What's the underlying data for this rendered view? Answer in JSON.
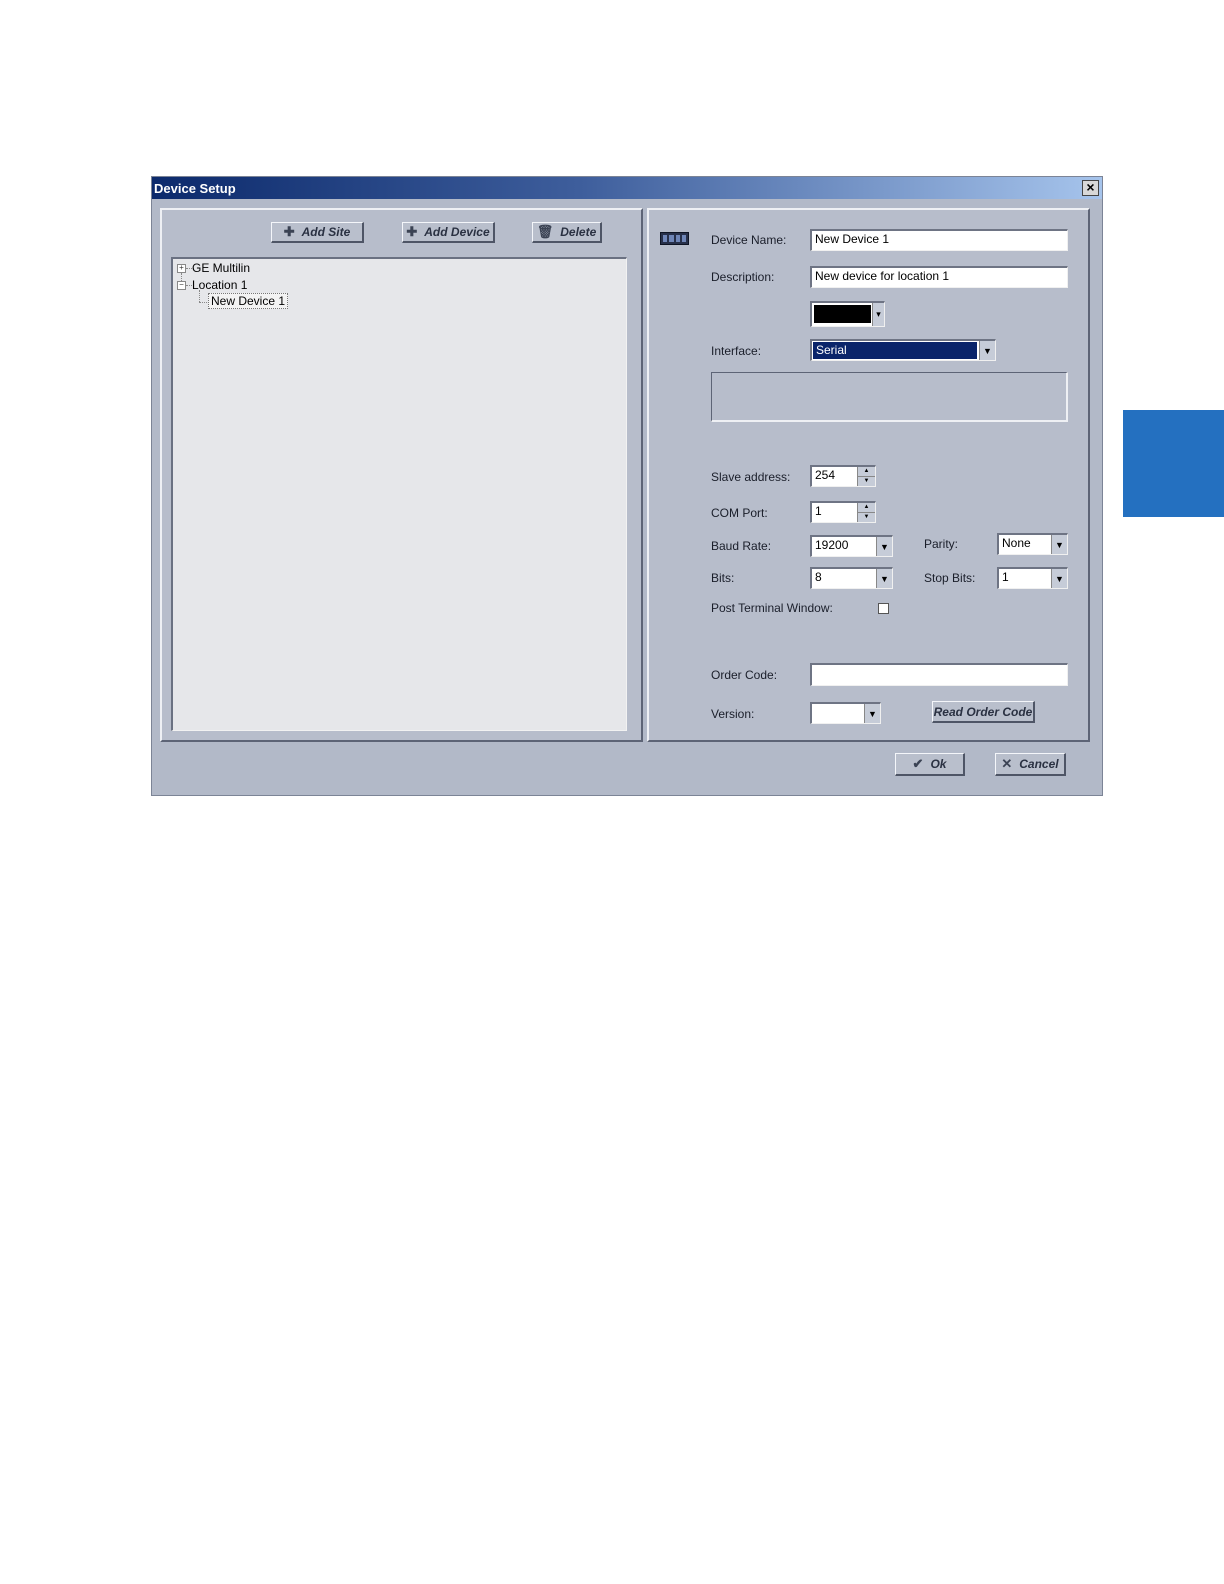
{
  "window": {
    "title": "Device Setup"
  },
  "left": {
    "buttons": {
      "add_site": "Add Site",
      "add_device": "Add Device",
      "delete": "Delete"
    },
    "tree": [
      {
        "label": "GE Multilin",
        "expander": "+"
      },
      {
        "label": "Location 1",
        "expander": "−"
      },
      {
        "label": "New Device 1"
      }
    ]
  },
  "right": {
    "device_name": {
      "label": "Device Name:",
      "value": "New Device 1"
    },
    "description": {
      "label": "Description:",
      "value": "New device for location 1"
    },
    "color": {
      "value": "#000000"
    },
    "interface": {
      "label": "Interface:",
      "value": "Serial"
    },
    "slave_address": {
      "label": "Slave address:",
      "value": "254"
    },
    "com_port": {
      "label": "COM Port:",
      "value": "1"
    },
    "baud_rate": {
      "label": "Baud Rate:",
      "value": "19200"
    },
    "parity": {
      "label": "Parity:",
      "value": "None"
    },
    "bits": {
      "label": "Bits:",
      "value": "8"
    },
    "stop_bits": {
      "label": "Stop Bits:",
      "value": "1"
    },
    "post_terminal": {
      "label": "Post Terminal Window:",
      "checked": false
    },
    "order_code": {
      "label": "Order Code:",
      "value": ""
    },
    "version": {
      "label": "Version:",
      "value": ""
    },
    "read_order_code": "Read Order Code"
  },
  "footer": {
    "ok": "Ok",
    "cancel": "Cancel"
  },
  "colors": {
    "side_tab": "#2470c0",
    "selection": "#0a246a"
  }
}
